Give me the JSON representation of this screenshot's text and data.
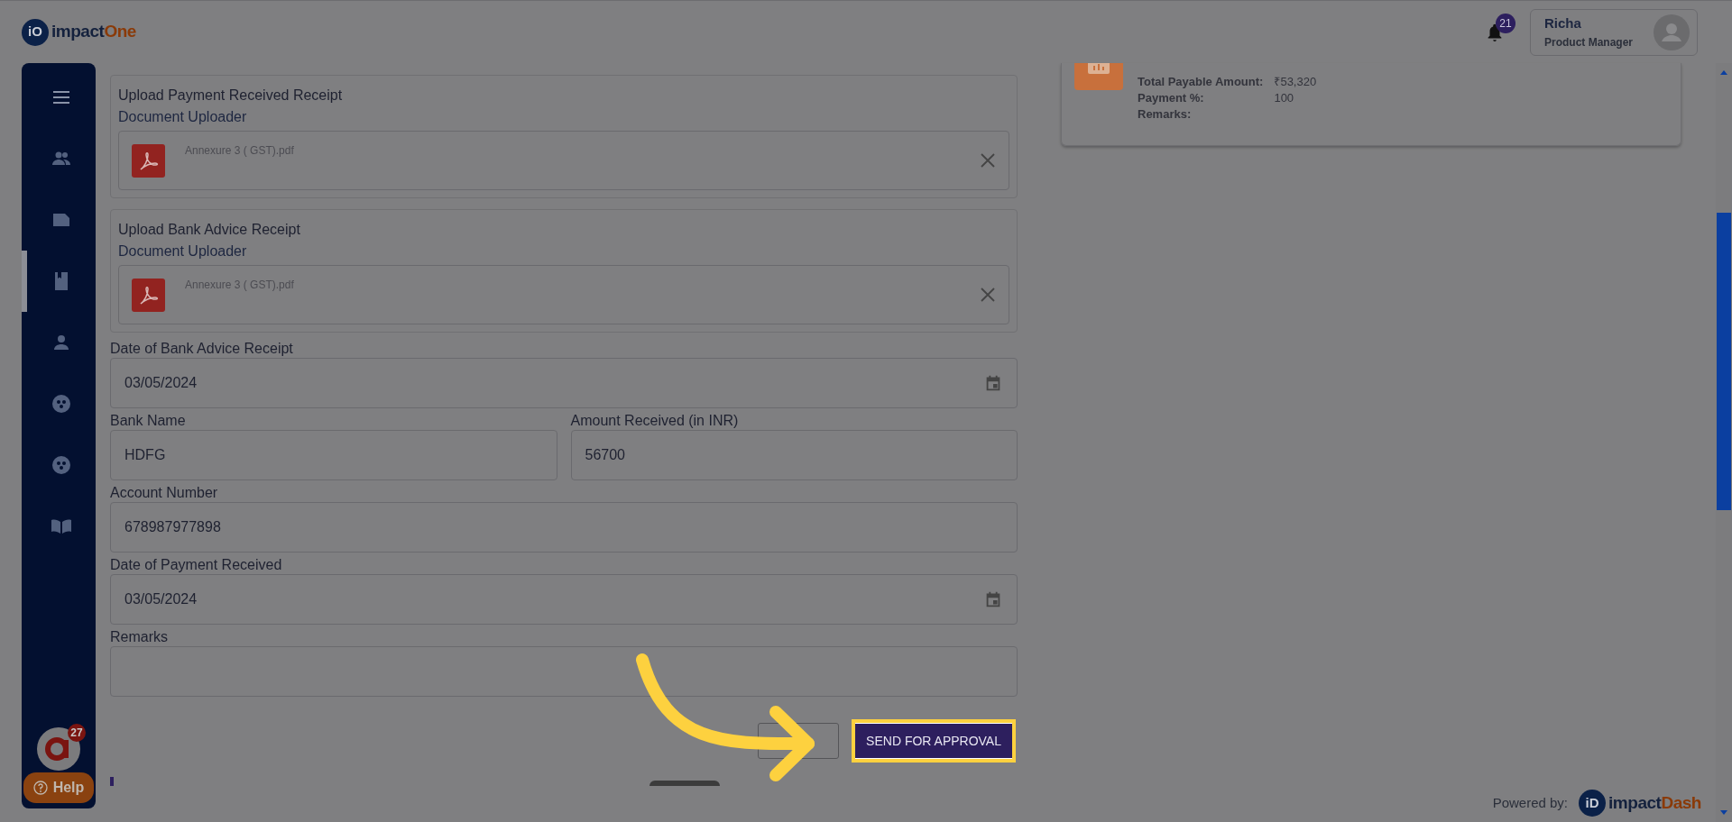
{
  "header": {
    "logo": {
      "mark": "iO",
      "name": "impact",
      "accent": "One"
    },
    "notifications": "21",
    "user": {
      "name": "Richa",
      "role": "Product Manager"
    }
  },
  "sidebar": {
    "items": [
      {
        "selected": false
      },
      {
        "selected": false
      },
      {
        "selected": false
      },
      {
        "selected": true
      },
      {
        "selected": false
      },
      {
        "selected": false
      },
      {
        "selected": false
      },
      {
        "selected": false
      }
    ],
    "chat_badge": "27",
    "help": "Help"
  },
  "uploads": [
    {
      "title": "Upload Payment Received Receipt",
      "subtitle": "Document Uploader",
      "file": "Annexure 3 ( GST).pdf"
    },
    {
      "title": "Upload Bank Advice Receipt",
      "subtitle": "Document Uploader",
      "file": "Annexure 3 ( GST).pdf"
    }
  ],
  "field_rows": [
    [
      {
        "label": "Date of Bank Advice Receipt",
        "value": "03/05/2024",
        "kind": "date"
      }
    ],
    [
      {
        "label": "Bank Name",
        "value": "HDFG",
        "kind": "text"
      },
      {
        "label": "Amount Received (in INR)",
        "value": "56700",
        "kind": "text"
      }
    ],
    [
      {
        "label": "Account Number",
        "value": "678987977898",
        "kind": "text"
      }
    ],
    [
      {
        "label": "Date of Payment Received",
        "value": "03/05/2024",
        "kind": "date"
      }
    ],
    [
      {
        "label": "Remarks",
        "kind": "text"
      }
    ]
  ],
  "submit": "SEND FOR APPROVAL",
  "summary": {
    "rows": [
      {
        "label": "Total Payable Amount:",
        "value": "₹53,320"
      },
      {
        "label": "Payment %:",
        "value": "100"
      },
      {
        "label": "Remarks:"
      }
    ]
  },
  "footer": {
    "label": "Powered by:",
    "logo": {
      "mark": "iD",
      "name": "impact",
      "accent": "Dash"
    }
  }
}
